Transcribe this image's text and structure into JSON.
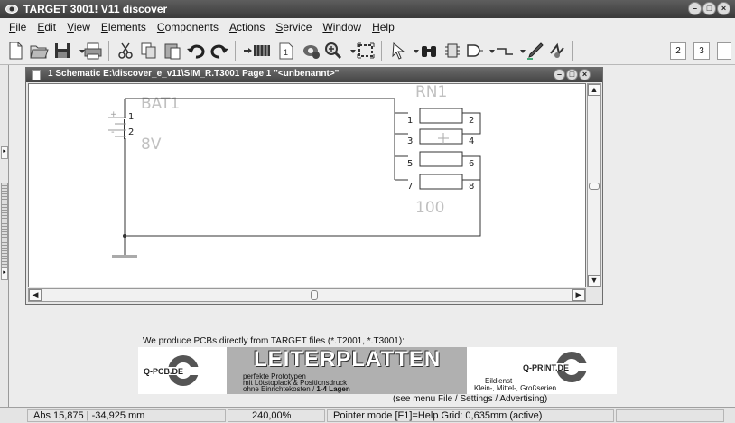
{
  "window": {
    "title": "TARGET 3001! V11 discover"
  },
  "menubar": {
    "items": [
      {
        "pre": "",
        "key": "F",
        "post": "ile"
      },
      {
        "pre": "",
        "key": "E",
        "post": "dit"
      },
      {
        "pre": "",
        "key": "V",
        "post": "iew"
      },
      {
        "pre": "",
        "key": "E",
        "post": "lements"
      },
      {
        "pre": "",
        "key": "C",
        "post": "omponents"
      },
      {
        "pre": "",
        "key": "A",
        "post": "ctions"
      },
      {
        "pre": "",
        "key": "S",
        "post": "ervice"
      },
      {
        "pre": "",
        "key": "W",
        "post": "indow"
      },
      {
        "pre": "",
        "key": "H",
        "post": "elp"
      }
    ]
  },
  "toolbar": {
    "num_buttons": [
      "2",
      "3"
    ]
  },
  "document": {
    "title": "1 Schematic E:\\discover_e_v11\\SIM_R.T3001 Page 1 \"<unbenannt>\""
  },
  "schematic": {
    "battery": {
      "name": "BAT1",
      "value": "8V",
      "pin1": "1",
      "pin2": "2",
      "plus": "+",
      "minus": "-"
    },
    "resistor_network": {
      "name": "RN1",
      "value": "100",
      "pins": [
        [
          "1",
          "2"
        ],
        [
          "3",
          "4"
        ],
        [
          "5",
          "6"
        ],
        [
          "7",
          "8"
        ]
      ]
    }
  },
  "advertising": {
    "caption": "We produce PCBs directly from TARGET files (*.T2001, *.T3001):",
    "headline": "LEITERPLATTEN",
    "left_logo": "Q-PCB.DE",
    "right_logo": "Q-PRINT.DE",
    "line1": "perfekte Prototypen",
    "line2": "mit Lötstoplack & Positionsdruck",
    "line3_pre": "ohne Einrichtekosten / ",
    "line3_bold": "1-4 Lagen",
    "right_line1": "Eildienst",
    "right_line2": "Klein-, Mittel-, Großserien",
    "hint": "(see menu File / Settings / Advertising)"
  },
  "statusbar": {
    "coords": "Abs 15,875 | -34,925 mm",
    "zoom": "240,00%",
    "mode": "Pointer mode  [F1]=Help  Grid: 0,635mm (active)"
  }
}
